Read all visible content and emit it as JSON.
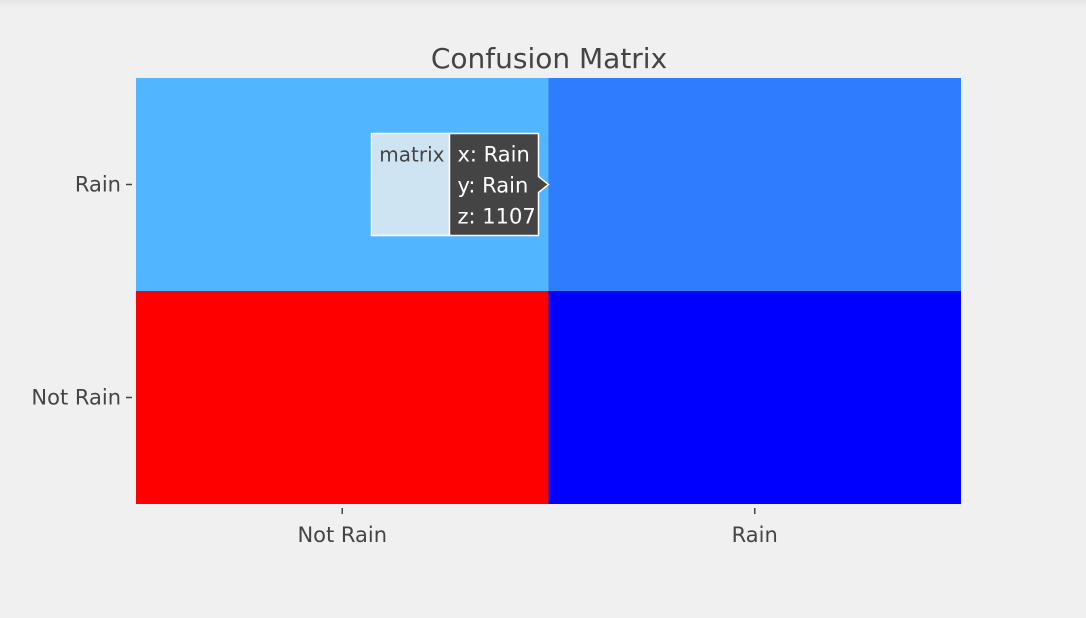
{
  "chart_data": {
    "type": "heatmap",
    "title": "Confusion Matrix",
    "xlabel": "",
    "ylabel": "",
    "x_categories": [
      "Not Rain",
      "Rain"
    ],
    "y_categories": [
      "Not Rain",
      "Rain"
    ],
    "cells": [
      {
        "x": "Not Rain",
        "y": "Rain",
        "color": "#52b5ff"
      },
      {
        "x": "Rain",
        "y": "Rain",
        "color": "#2e7dff",
        "z": 1107
      },
      {
        "x": "Not Rain",
        "y": "Not Rain",
        "color": "#ff0000"
      },
      {
        "x": "Rain",
        "y": "Not Rain",
        "color": "#0000ff"
      }
    ],
    "hover": {
      "trace_name": "matrix",
      "lines": [
        "x: Rain",
        "y: Rain",
        "z: 1107"
      ]
    },
    "colors": {
      "background": "#f0f0f0",
      "text": "#444444",
      "hover_bg": "#444444",
      "hover_name_bg": "#cfe4f3"
    }
  }
}
